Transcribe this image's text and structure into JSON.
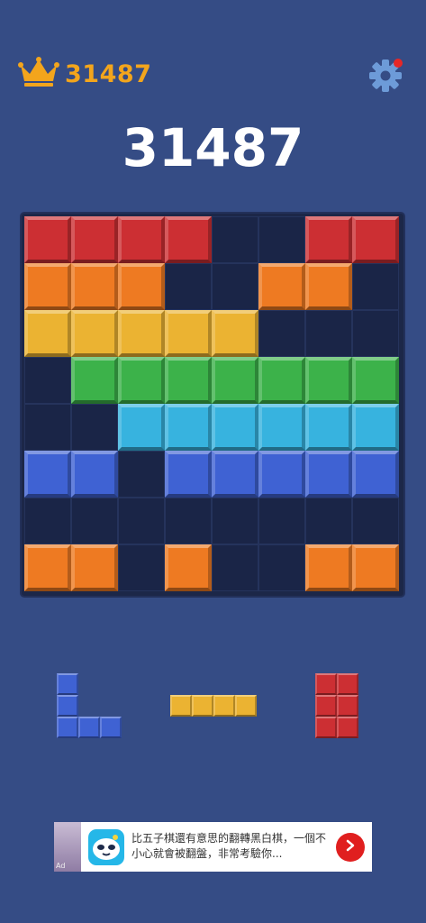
{
  "header": {
    "best_score": "31487",
    "crown_icon": "crown-icon",
    "settings_icon": "gear-icon",
    "has_notification": true
  },
  "score": "31487",
  "colors": {
    "red": "#cc2f33",
    "orange": "#ee7a22",
    "yellow": "#ebb332",
    "green": "#3cb24a",
    "cyan": "#37b3df",
    "blue": "#3f62d3",
    "board_empty": "#1a2547",
    "accent": "#f3a51c"
  },
  "board": {
    "rows": 8,
    "cols": 8,
    "cells": [
      [
        "red",
        "red",
        "red",
        "red",
        "",
        "",
        "red",
        "red"
      ],
      [
        "orange",
        "orange",
        "orange",
        "",
        "",
        "orange",
        "orange",
        ""
      ],
      [
        "yellow",
        "yellow",
        "yellow",
        "yellow",
        "yellow",
        "",
        "",
        ""
      ],
      [
        "",
        "green",
        "green",
        "green",
        "green",
        "green",
        "green",
        "green"
      ],
      [
        "",
        "",
        "cyan",
        "cyan",
        "cyan",
        "cyan",
        "cyan",
        "cyan"
      ],
      [
        "blue",
        "blue",
        "",
        "blue",
        "blue",
        "blue",
        "blue",
        "blue"
      ],
      [
        "",
        "",
        "",
        "",
        "",
        "",
        "",
        ""
      ],
      [
        "orange",
        "orange",
        "",
        "orange",
        "",
        "",
        "orange",
        "orange"
      ]
    ]
  },
  "pieces": [
    {
      "name": "piece-l-blue",
      "color": "blue",
      "shape": [
        [
          1,
          0,
          0
        ],
        [
          1,
          0,
          0
        ],
        [
          1,
          1,
          1
        ]
      ]
    },
    {
      "name": "piece-i-yellow",
      "color": "yellow",
      "shape": [
        [
          1,
          1,
          1,
          1
        ]
      ]
    },
    {
      "name": "piece-block-red",
      "color": "red",
      "shape": [
        [
          1,
          1
        ],
        [
          1,
          1
        ],
        [
          1,
          1
        ]
      ]
    }
  ],
  "ad": {
    "tag": "Ad",
    "text": "比五子棋還有意思的翻轉黑白棋，一個不小心就會被翻盤，非常考驗你...",
    "icon": "mascot-icon",
    "cta_icon": "chevron-right-icon"
  }
}
